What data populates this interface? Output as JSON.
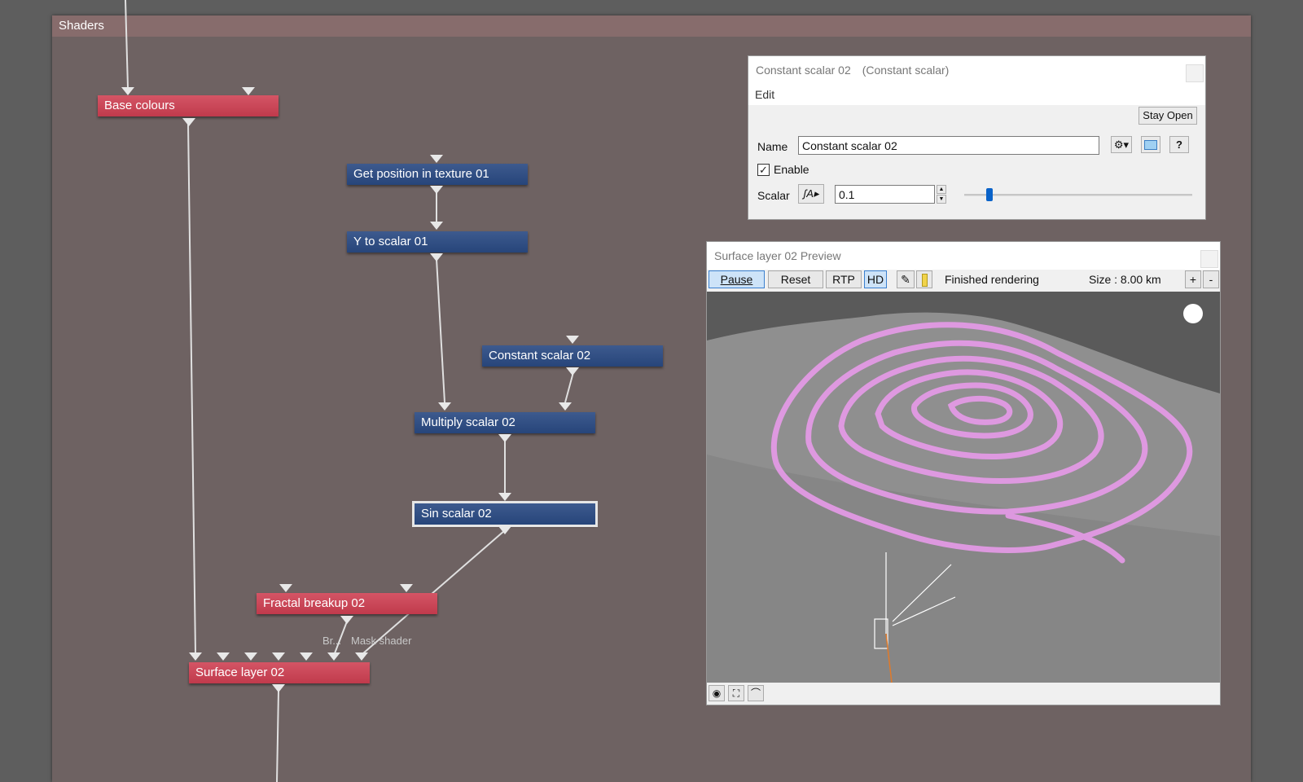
{
  "shaders_panel": {
    "title": "Shaders"
  },
  "nodes": {
    "base_colours": "Base colours",
    "get_position": "Get position in texture 01",
    "y_to_scalar": "Y to scalar 01",
    "constant_scalar": "Constant scalar 02",
    "multiply_scalar": "Multiply scalar 02",
    "sin_scalar": "Sin scalar 02",
    "fractal_breakup": "Fractal breakup 02",
    "surface_layer": "Surface layer 02",
    "port_labels": {
      "breakup": "Br...",
      "mask": "Mask shader"
    }
  },
  "dialog": {
    "title": "Constant scalar 02",
    "subtitle": "(Constant scalar)",
    "menu_edit": "Edit",
    "stay_open": "Stay Open",
    "name_label": "Name",
    "name_value": "Constant scalar 02",
    "enable_label": "Enable",
    "enable_checked": true,
    "scalar_label": "Scalar",
    "scalar_value": "0.1",
    "scalar_slider_fraction": 0.11,
    "help": "?"
  },
  "preview": {
    "title": "Surface layer 02 Preview",
    "toolbar": {
      "pause": "Pause",
      "reset": "Reset",
      "rtp": "RTP",
      "hd": "HD",
      "status": "Finished rendering",
      "size": "Size : 8.00 km",
      "zoom_in": "+",
      "zoom_out": "-"
    },
    "colors": {
      "terrain": "#8f8f8f",
      "stripes": "#e79be9",
      "sky": "#5a5a5a"
    }
  }
}
